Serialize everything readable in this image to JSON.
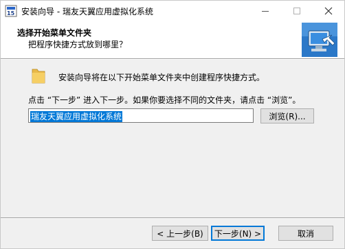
{
  "window": {
    "title": "安装向导 - 瑞友天翼应用虚拟化系统"
  },
  "header": {
    "title": "选择开始菜单文件夹",
    "subtitle": "把程序快捷方式放到哪里？"
  },
  "body": {
    "intro": "安装向导将在以下开始菜单文件夹中创建程序快捷方式。",
    "info": "点击 “下一步” 进入下一步。如果你要选择不同的文件夹，请点击 “浏览”。",
    "folder_value": "瑞友天翼应用虚拟化系统",
    "browse_label": "浏览(R)..."
  },
  "footer": {
    "back_label": "< 上一步(B)",
    "next_label": "下一步(N) >",
    "cancel_label": "取消"
  },
  "icons": {
    "app": "setup-app-icon",
    "header": "computer-shortcut-icon",
    "folder": "folder-icon",
    "minimize": "minimize-icon",
    "maximize": "maximize-icon",
    "close": "close-icon"
  },
  "colors": {
    "selection": "#0078d7",
    "default_button_border": "#0078d7"
  }
}
